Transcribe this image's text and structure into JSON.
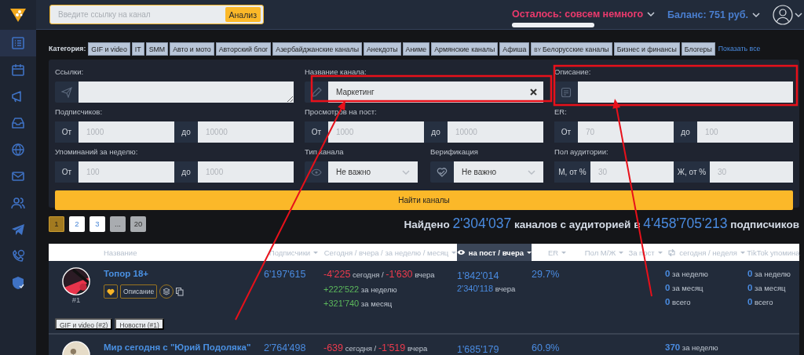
{
  "sidebar": {
    "items": [
      {
        "selected": true
      },
      {
        "selected": false
      },
      {
        "selected": false
      },
      {
        "selected": false
      },
      {
        "selected": false
      },
      {
        "selected": false
      },
      {
        "selected": false
      },
      {
        "selected": false
      },
      {
        "selected": false
      },
      {
        "selected": false
      }
    ]
  },
  "header": {
    "search": {
      "placeholder": "Введите ссылку на канал"
    },
    "analyze_button": "Анализ",
    "remaining": "Осталось: совсем немного",
    "balance": "Баланс: 751 руб.",
    "quota": {
      "level": 1
    }
  },
  "categories": {
    "label": "Категория:",
    "items": [
      {
        "label": "GIF и video"
      },
      {
        "label": "IT"
      },
      {
        "label": "SMM"
      },
      {
        "label": "Авто и мото"
      },
      {
        "label": "Авторский блог"
      },
      {
        "label": "Азербайджанские каналы"
      },
      {
        "label": "Анекдоты"
      },
      {
        "label": "Аниме"
      },
      {
        "label": "Армянские каналы"
      },
      {
        "label": "Афиша"
      },
      {
        "label": "Белорусские каналы",
        "flag": "BY"
      },
      {
        "label": "Бизнес и финансы"
      },
      {
        "label": "Блогеры"
      }
    ],
    "show_all": "Показать все"
  },
  "filters": {
    "links": {
      "label": "Ссылки:"
    },
    "channel_name": {
      "label": "Название канала:",
      "value": "Маркетинг"
    },
    "description": {
      "label": "Описание:"
    },
    "subscribers": {
      "label": "Подписчиков:",
      "from": "От",
      "from_placeholder": "1000",
      "to": "до",
      "to_placeholder": "10000"
    },
    "views": {
      "label": "Просмотров на пост:",
      "from": "От",
      "from_placeholder": "1000",
      "to": "до",
      "to_placeholder": "10000"
    },
    "er": {
      "label": "ER:",
      "from": "От",
      "from_placeholder": "70",
      "to": "до",
      "to_placeholder": "100"
    },
    "mentions": {
      "label": "Упоминаний за неделю:",
      "from": "От",
      "from_placeholder": "100",
      "to": "до",
      "to_placeholder": "1000"
    },
    "channel_type": {
      "label": "Тип канала",
      "value": "Не важно"
    },
    "verification": {
      "label": "Верификация",
      "value": "Не важно"
    },
    "gender": {
      "label": "Пол аудитории:",
      "from": "М, от %",
      "from_placeholder": "30",
      "to": "Ж, от %",
      "to_placeholder": "30"
    },
    "submit": "Найти каналы"
  },
  "pagination": {
    "pages": [
      {
        "label": "1",
        "selected": true,
        "kind": "current"
      },
      {
        "label": "2",
        "selected": false,
        "kind": "link"
      },
      {
        "label": "3",
        "selected": false,
        "kind": "link"
      },
      {
        "label": "...",
        "selected": false,
        "kind": "muted"
      },
      {
        "label": "20",
        "selected": false,
        "kind": "muted"
      }
    ]
  },
  "summary": "Найдено **2'304'037** каналов с аудиторией в **4'458'705'213** подписчиков",
  "table": {
    "columns": [
      {
        "label": "Название",
        "selected": false
      },
      {
        "label": "Подписчики",
        "sortable": true,
        "selected": false
      },
      {
        "label": "Сегодня / вчера / за неделю / месяц",
        "sortable": true,
        "selected": false
      },
      {
        "label": "на пост / вчера",
        "sortable": true,
        "selected": true
      },
      {
        "label": "ER",
        "sortable": true,
        "selected": false
      },
      {
        "label": "Пол М/Ж",
        "sortable": true,
        "selected": false
      },
      {
        "label": "За пост",
        "sortable": true,
        "selected": false
      },
      {
        "label": "сегодня / неделя",
        "sortable": true,
        "selected": false
      },
      {
        "label": "TikTok упомина",
        "selected": false
      }
    ],
    "rows": [
      {
        "rank": "#1",
        "name": "Топор 18+",
        "description_button": "Описание",
        "tags": [
          "GIF и video (#2)",
          "Новости (#1)"
        ],
        "subscribers": "6'197'615",
        "today": [
          "**-4'225** сегодня / **-1'630** вчера"
        ],
        "growth": [
          "**+222'522** за неделю",
          "**+321'740** за месяц"
        ],
        "views": "1'842'014",
        "views_yesterday": "**2'340'118** вчера",
        "er": "29.7%",
        "reposts": [
          "**0** за неделю",
          "**0** за месяц",
          "**0** всего"
        ],
        "tiktok": [
          "**0** за неделю",
          "**0** за месяц",
          "**0** всего"
        ]
      },
      {
        "name": "Мир сегодня с \"Юрий Подоляка\"",
        "subscribers": "2'764'498",
        "today": [
          "**-639** сегодня / **-1'519** вчера"
        ],
        "views": "1'685'179",
        "er": "60.9%",
        "reposts": [
          "**370** за неделю"
        ]
      }
    ]
  }
}
